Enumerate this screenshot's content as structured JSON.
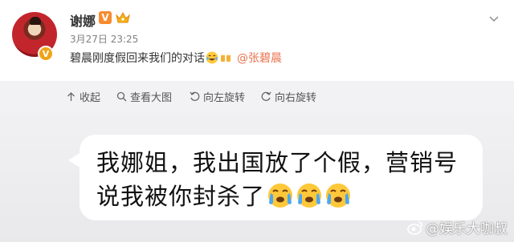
{
  "post": {
    "username": "谢娜",
    "verified_mark": "V",
    "avatar_badge": "V",
    "timestamp": "3月27日 23:25",
    "text": "碧晨刚度假回来我们的对话",
    "mention": "@张碧晨"
  },
  "toolbar": {
    "collapse": "收起",
    "view_large": "查看大图",
    "rotate_left": "向左旋转",
    "rotate_right": "向右旋转"
  },
  "image": {
    "line1": "我娜姐，我出国放了个假，营销号",
    "line2": "说我被你封杀了",
    "watermark": "@娱乐大咖叔"
  },
  "colors": {
    "mention": "#eb7350",
    "verified": "#f78b2e",
    "toolbar_bg": "#f2f2f5"
  },
  "icons": [
    "crown-icon",
    "more-chevron-icon",
    "collapse-icon",
    "zoom-icon",
    "rotate-left-icon",
    "rotate-right-icon",
    "laugh-cry-emoji",
    "crying-emoji",
    "weibo-logo-icon"
  ]
}
